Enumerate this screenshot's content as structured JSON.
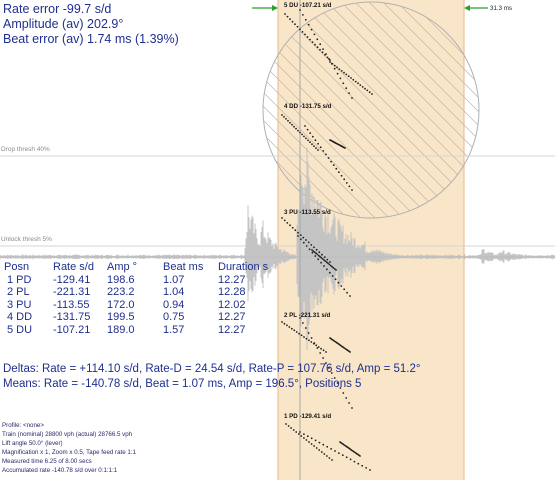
{
  "header": {
    "rate_error": "Rate error  -99.7 s/d",
    "amplitude": "Amplitude (av) 202.9°",
    "beat_error": "Beat error (av) 1.74 ms (1.39%)"
  },
  "thresholds": {
    "drop": "Drop thresh 40%",
    "unlock": "Unlock thresh 5%"
  },
  "table": {
    "headers": [
      "Posn",
      "Rate s/d",
      "Amp °",
      "Beat ms",
      "Duration s"
    ],
    "rows": [
      [
        "1 PD",
        "-129.41",
        "198.6",
        "1.07",
        "12.27"
      ],
      [
        "2 PL",
        "-221.31",
        "223.2",
        "1.04",
        "12.28"
      ],
      [
        "3 PU",
        "-113.55",
        "172.0",
        "0.94",
        "12.02"
      ],
      [
        "4 DD",
        "-131.75",
        "199.5",
        "0.75",
        "12.27"
      ],
      [
        "5 DU",
        "-107.21",
        "189.0",
        "1.57",
        "12.27"
      ]
    ]
  },
  "summary": {
    "deltas": "Deltas:  Rate = +114.10 s/d, Rate-D = 24.54 s/d, Rate-P = 107.76 s/d, Amp =  51.2°",
    "means": "Means:  Rate = -140.78 s/d, Beat = 1.07 ms, Amp = 196.5°, Positions 5"
  },
  "profile": [
    "Profile: <none>",
    "Train (nominal) 28800 vph (actual) 28766.5 vph",
    "Lift angle  50.0° (lever)",
    "Magnification x 1, Zoom x 0.5, Tape feed rate 1:1",
    "Measured time 6.25 of 8.00 secs",
    "Accumulated rate -140.78 s/d over 0:1:1:1"
  ],
  "positions": [
    {
      "label": "5 DU  -107.21 s/d"
    },
    {
      "label": "4 DD  -131.75 s/d"
    },
    {
      "label": "3 PU  -113.55 s/d"
    },
    {
      "label": "2 PL  -221.31 s/d"
    },
    {
      "label": "1 PD  -129.41 s/d"
    }
  ],
  "marker_ms": "31.3 ms",
  "colors": {
    "text": "#1f2f8f",
    "band": "#f9e6c8",
    "waveform": "#c4c4c4",
    "marker": "#2ca02c",
    "threshold": "#d6d6d6"
  }
}
